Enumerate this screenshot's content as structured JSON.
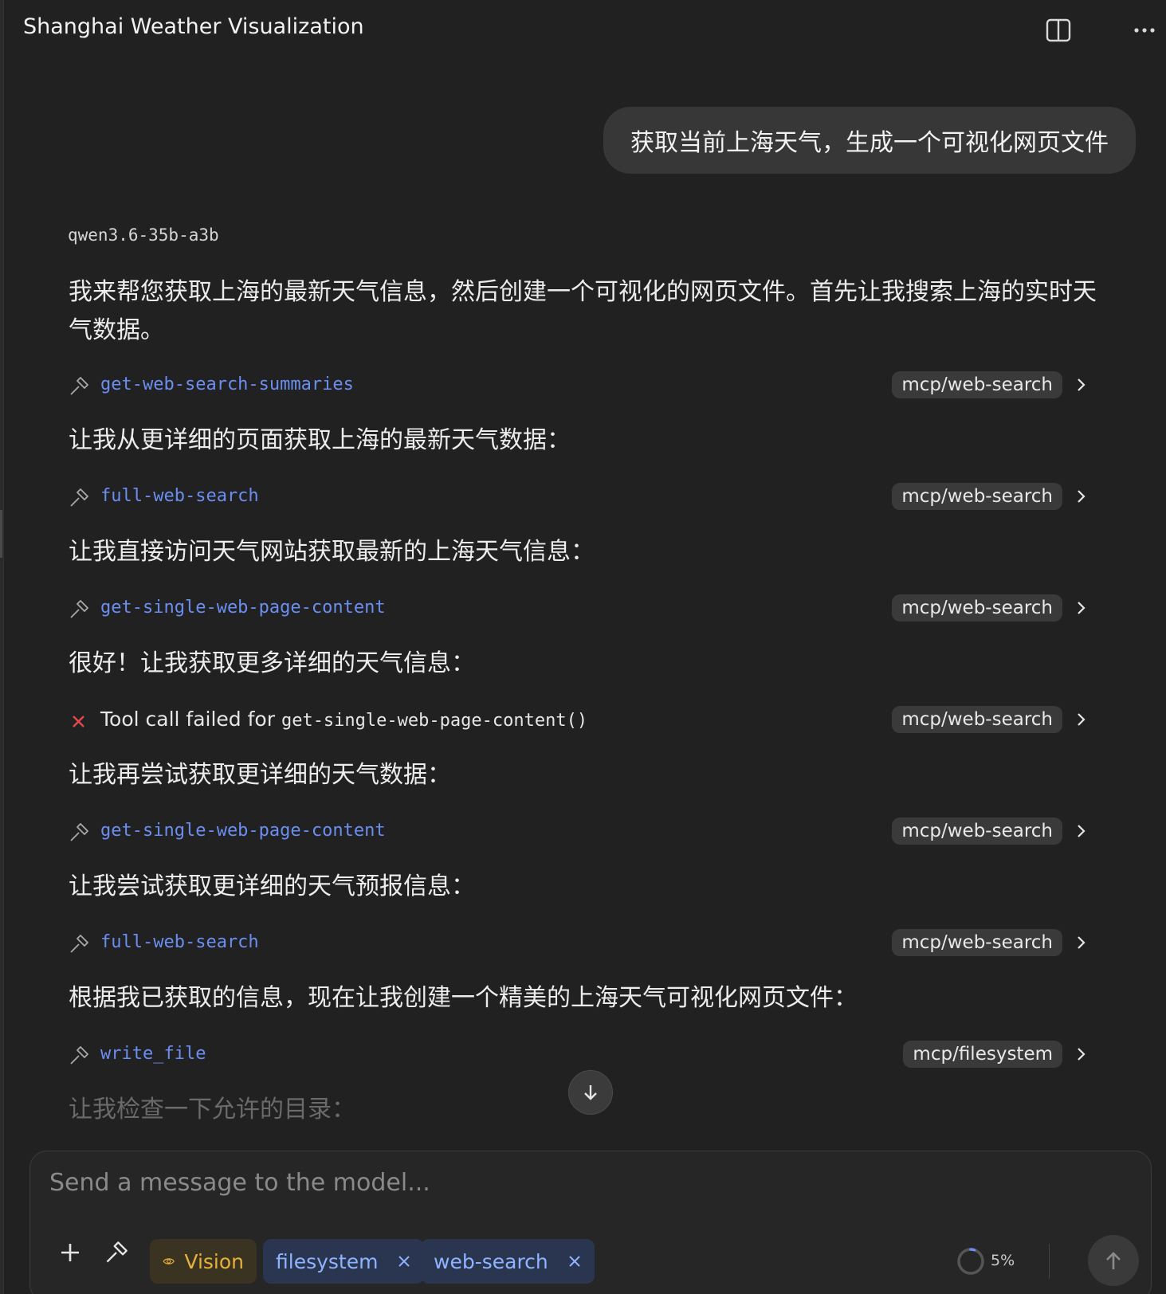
{
  "header": {
    "title": "Shanghai Weather Visualization",
    "split_icon": "split-view-icon",
    "more_icon": "more-options-icon"
  },
  "chat": {
    "user_message": "获取当前上海天气，生成一个可视化网页文件",
    "model_name": "qwen3.6-35b-a3b",
    "intro": "我来帮您获取上海的最新天气信息，然后创建一个可视化的网页文件。首先让我搜索上海的实时天气数据。",
    "steps": [
      {
        "tool": "get-web-search-summaries",
        "source": "mcp/web-search",
        "after": "让我从更详细的页面获取上海的最新天气数据："
      },
      {
        "tool": "full-web-search",
        "source": "mcp/web-search",
        "after": "让我直接访问天气网站获取最新的上海天气信息："
      },
      {
        "tool": "get-single-web-page-content",
        "source": "mcp/web-search",
        "after": "很好！让我获取更多详细的天气信息："
      },
      {
        "failed_prefix": "Tool call failed for ",
        "failed_fn": "get-single-web-page-content()",
        "source": "mcp/web-search",
        "after": "让我再尝试获取更详细的天气数据："
      },
      {
        "tool": "get-single-web-page-content",
        "source": "mcp/web-search",
        "after": "让我尝试获取更详细的天气预报信息："
      },
      {
        "tool": "full-web-search",
        "source": "mcp/web-search",
        "after": "根据我已获取的信息，现在让我创建一个精美的上海天气可视化网页文件："
      },
      {
        "tool": "write_file",
        "source": "mcp/filesystem",
        "after": "让我检查一下允许的目录："
      }
    ],
    "tool_icon": "hammer-icon",
    "fail_icon": "error-x-icon"
  },
  "composer": {
    "placeholder": "Send a message to the model...",
    "chips": {
      "vision": "Vision",
      "filesystem": "filesystem",
      "web_search": "web-search"
    },
    "context_usage": "5%",
    "context_fraction": 0.05
  },
  "colors": {
    "background": "#212121",
    "tool_name": "#6b8ef2",
    "vision_chip": "#e7b13b",
    "error": "#e5484d"
  }
}
